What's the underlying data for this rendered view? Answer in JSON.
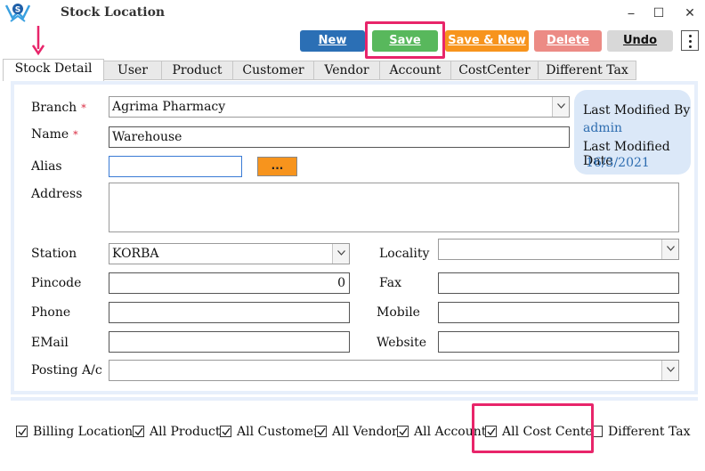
{
  "window": {
    "title": "Stock Location",
    "minimize": "⎯",
    "maximize": "☐",
    "close": "✕"
  },
  "toolbar": {
    "new": "New",
    "save": "Save",
    "save_new": "Save & New",
    "delete": "Delete",
    "undo": "Undo",
    "colors": {
      "new": "#2b6fb5",
      "save": "#58b85c",
      "save_new": "#f7941d",
      "delete": "#ec8b85",
      "undo": "#d8d8d8"
    }
  },
  "tabs": [
    "Stock Detail",
    "User",
    "Product",
    "Customer",
    "Vendor",
    "Account",
    "CostCenter",
    "Different Tax"
  ],
  "form": {
    "branch_label": "Branch",
    "branch_value": "Agrima Pharmacy",
    "name_label": "Name",
    "name_value": "Warehouse",
    "required_mark": "*",
    "alias_label": "Alias",
    "alias_value": "",
    "alias_button": "...",
    "address_label": "Address",
    "address_value": "",
    "station_label": "Station",
    "station_value": "KORBA",
    "locality_label": "Locality",
    "locality_value": "",
    "pincode_label": "Pincode",
    "pincode_value": "0",
    "fax_label": "Fax",
    "fax_value": "",
    "phone_label": "Phone",
    "phone_value": "",
    "mobile_label": "Mobile",
    "mobile_value": "",
    "email_label": "EMail",
    "email_value": "",
    "website_label": "Website",
    "website_value": "",
    "posting_label": "Posting A/c",
    "posting_value": ""
  },
  "info": {
    "modified_by_label": "Last Modified By",
    "modified_by_value": "admin",
    "modified_date_label": "Last Modified Date",
    "modified_date_value": "16/3/2021"
  },
  "checkboxes": [
    {
      "label": "Billing Location",
      "checked": true
    },
    {
      "label": "All Product",
      "checked": true
    },
    {
      "label": "All Customer",
      "checked": true
    },
    {
      "label": "All Vendor",
      "checked": true
    },
    {
      "label": "All Account",
      "checked": true
    },
    {
      "label": "All Cost Center",
      "checked": true
    },
    {
      "label": "Different Tax",
      "checked": false
    }
  ],
  "colors": {
    "highlight": "#e8256a",
    "accent": "#2e6db0"
  },
  "icons": [
    "app-logo-icon",
    "arrow-down-icon",
    "menu-dots-icon",
    "chevron-down-icon",
    "checkmark-icon"
  ]
}
